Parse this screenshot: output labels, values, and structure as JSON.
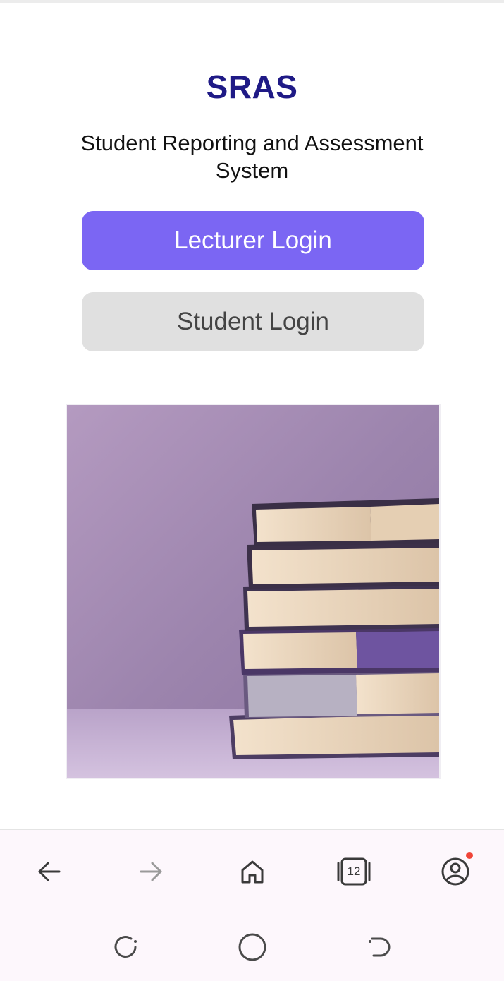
{
  "app": {
    "title": "SRAS",
    "subtitle": "Student Reporting and Assessment System"
  },
  "buttons": {
    "lecturer_login": "Lecturer Login",
    "student_login": "Student Login"
  },
  "image": {
    "icon": "stack-of-books-image"
  },
  "browser_nav": {
    "tab_count": "12",
    "icons": [
      "back-arrow-icon",
      "forward-arrow-icon",
      "home-icon",
      "tabs-icon",
      "account-icon"
    ]
  },
  "system_nav": {
    "icons": [
      "recents-icon",
      "home-circle-icon",
      "back-gesture-icon"
    ]
  },
  "colors": {
    "title": "#1f1a86",
    "primary_button": "#7b66f3",
    "secondary_button": "#e0e0e0",
    "notification_dot": "#f04438",
    "bar_background": "#fdf7fc"
  }
}
